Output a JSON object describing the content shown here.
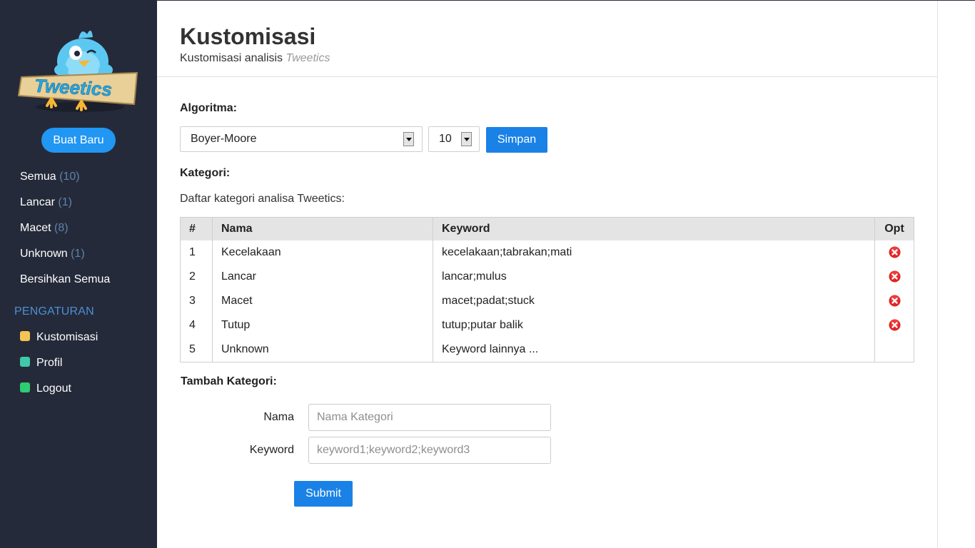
{
  "brand": {
    "logo_text": "Tweetics"
  },
  "sidebar": {
    "new_button": "Buat Baru",
    "nav": [
      {
        "label": "Semua",
        "count": "(10)"
      },
      {
        "label": "Lancar",
        "count": "(1)"
      },
      {
        "label": "Macet",
        "count": "(8)"
      },
      {
        "label": "Unknown",
        "count": "(1)"
      },
      {
        "label": "Bersihkan Semua"
      }
    ],
    "section_title": "PENGATURAN",
    "settings": [
      {
        "label": "Kustomisasi",
        "color": "#f5c453"
      },
      {
        "label": "Profil",
        "color": "#3fc8a9"
      },
      {
        "label": "Logout",
        "color": "#2ecc71"
      }
    ]
  },
  "header": {
    "title": "Kustomisasi",
    "subtitle_prefix": "Kustomisasi analisis",
    "subtitle_em": "Tweetics"
  },
  "algorithm": {
    "label": "Algoritma:",
    "selected": "Boyer-Moore",
    "number": "10",
    "save_button": "Simpan"
  },
  "categories": {
    "label": "Kategori:",
    "description": "Daftar kategori analisa Tweetics:",
    "columns": [
      "#",
      "Nama",
      "Keyword",
      "Opt"
    ],
    "rows": [
      {
        "no": "1",
        "name": "Kecelakaan",
        "keyword": "kecelakaan;tabrakan;mati",
        "deletable": true
      },
      {
        "no": "2",
        "name": "Lancar",
        "keyword": "lancar;mulus",
        "deletable": true
      },
      {
        "no": "3",
        "name": "Macet",
        "keyword": "macet;padat;stuck",
        "deletable": true
      },
      {
        "no": "4",
        "name": "Tutup",
        "keyword": "tutup;putar balik",
        "deletable": true
      },
      {
        "no": "5",
        "name": "Unknown",
        "keyword": "Keyword lainnya ...",
        "deletable": false
      }
    ]
  },
  "add_form": {
    "title": "Tambah Kategori:",
    "name_label": "Nama",
    "name_placeholder": "Nama Kategori",
    "keyword_label": "Keyword",
    "keyword_placeholder": "keyword1;keyword2;keyword3",
    "submit": "Submit"
  },
  "colors": {
    "sidebar_bg": "#252a3a",
    "accent": "#1a82e6",
    "pill_button": "#2196f3",
    "delete_red": "#e02424"
  }
}
